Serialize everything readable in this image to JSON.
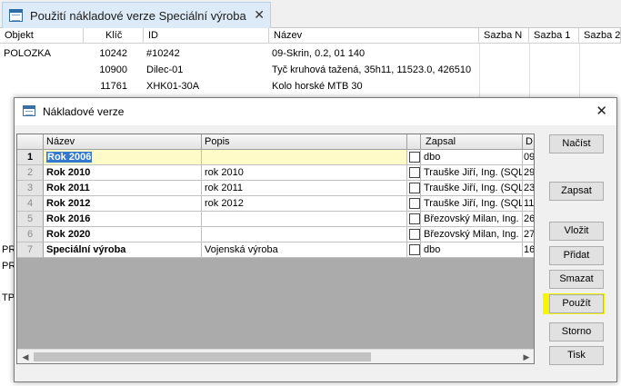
{
  "tab": {
    "title": "Použití nákladové verze Speciální výroba",
    "close_glyph": "✕"
  },
  "background": {
    "columns": [
      "Objekt",
      "Klíč",
      "ID",
      "Název",
      "Sazba N",
      "Sazba 1",
      "Sazba 2"
    ],
    "rows": [
      {
        "objekt": "POLOZKA",
        "klic": "10242",
        "id": "#10242",
        "nazev": "09-Skrin, 0.2, 01 140"
      },
      {
        "objekt": "",
        "klic": "10900",
        "id": "Dilec-01",
        "nazev": "Tyč kruhová tažená, 35h11, 11523.0, 426510"
      },
      {
        "objekt": "",
        "klic": "11761",
        "id": "XHK01-30A",
        "nazev": "Kolo horské MTB 30"
      }
    ],
    "left_partial": [
      "PR",
      "PR",
      "TP"
    ]
  },
  "dialog": {
    "title": "Nákladové verze",
    "close_glyph": "✕",
    "columns": [
      "Název",
      "Popis",
      "Zapsal",
      "D"
    ],
    "rows": [
      {
        "num": "1",
        "nazev": "Rok 2006",
        "popis": "",
        "zapsal": "dbo",
        "d": "09"
      },
      {
        "num": "2",
        "nazev": "Rok 2010",
        "popis": "rok 2010",
        "zapsal": "Trauške Jiří, Ing. (SQL)",
        "d": "29"
      },
      {
        "num": "3",
        "nazev": "Rok 2011",
        "popis": "rok 2011",
        "zapsal": "Trauške Jiří, Ing. (SQL)",
        "d": "23"
      },
      {
        "num": "4",
        "nazev": "Rok 2012",
        "popis": "rok 2012",
        "zapsal": "Trauške Jiří, Ing. (SQL)",
        "d": "11"
      },
      {
        "num": "5",
        "nazev": "Rok 2016",
        "popis": "",
        "zapsal": "Březovský Milan, Ing. (",
        "d": "26"
      },
      {
        "num": "6",
        "nazev": "Rok 2020",
        "popis": "",
        "zapsal": "Březovský Milan, Ing. (",
        "d": "27"
      },
      {
        "num": "7",
        "nazev": "Speciální výroba",
        "popis": "Vojenská výroba",
        "zapsal": "dbo",
        "d": "16"
      }
    ],
    "scroll_left_glyph": "◀",
    "scroll_right_glyph": "▶",
    "buttons": {
      "nacist": "Načíst",
      "zapsat": "Zapsat",
      "vlozit": "Vložit",
      "pridat": "Přidat",
      "smazat": "Smazat",
      "pouzit": "Použít",
      "storno": "Storno",
      "tisk": "Tisk"
    },
    "highlight_color": "#f6f600",
    "selection_color": "#3478d0"
  }
}
